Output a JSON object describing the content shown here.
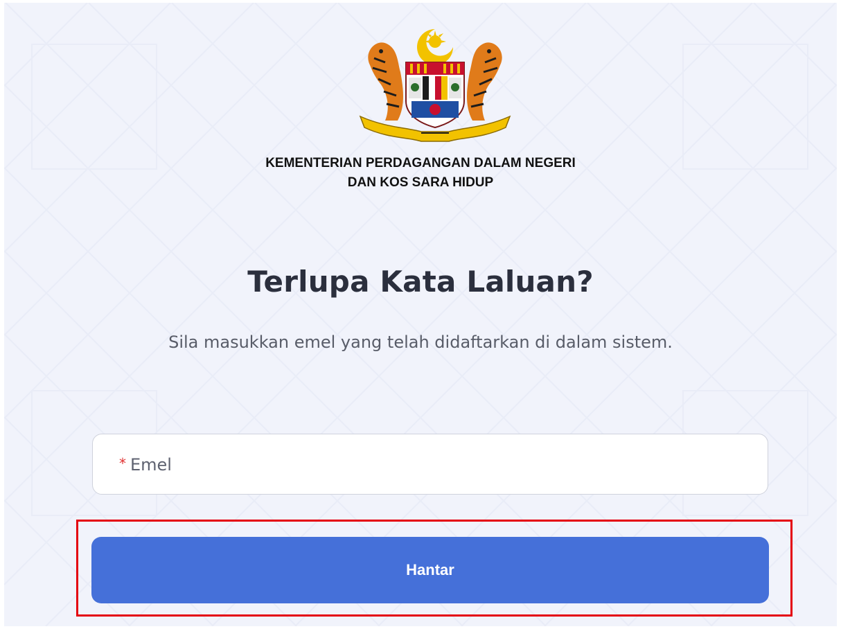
{
  "header": {
    "crest_icon": "malaysia-coat-of-arms-icon",
    "ministry_line1": "KEMENTERIAN PERDAGANGAN DALAM NEGERI",
    "ministry_line2": "DAN KOS SARA HIDUP"
  },
  "form": {
    "title": "Terlupa Kata Laluan?",
    "subtitle": "Sila masukkan emel yang telah didaftarkan di dalam sistem.",
    "email": {
      "required_mark": "*",
      "label": "Emel",
      "value": ""
    },
    "submit_label": "Hantar"
  },
  "colors": {
    "page_background": "#f1f3fb",
    "primary_button": "#4570d9",
    "required_mark": "#e03131",
    "highlight_border": "#e4000f",
    "title_text": "#2b2f3d"
  }
}
